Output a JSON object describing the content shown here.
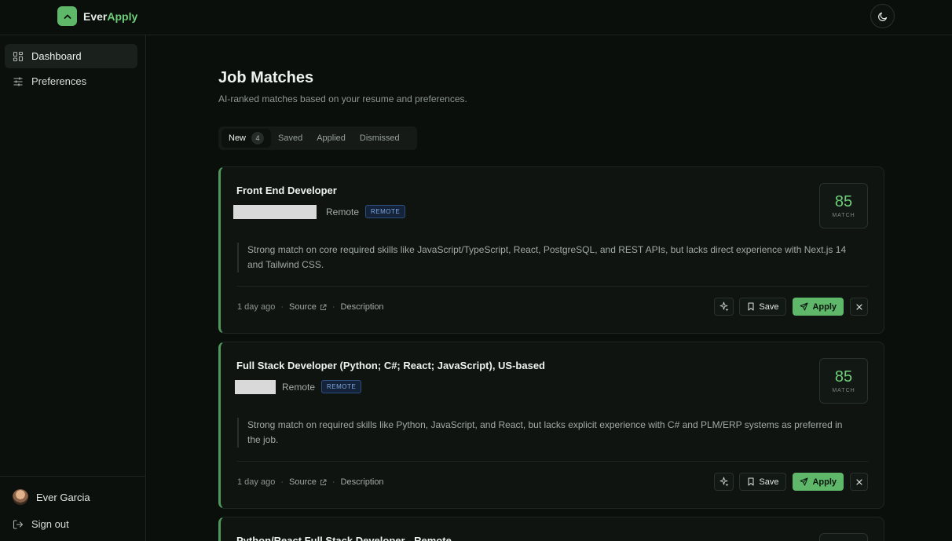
{
  "app": {
    "brand_part1": "Ever",
    "brand_part2": "Apply",
    "accent": "#5fb86a"
  },
  "sidebar": {
    "items": [
      {
        "label": "Dashboard",
        "icon": "grid-icon",
        "active": true
      },
      {
        "label": "Preferences",
        "icon": "sliders-icon",
        "active": false
      }
    ],
    "user_name": "Ever Garcia",
    "signout_label": "Sign out"
  },
  "main": {
    "title": "Job Matches",
    "subtitle": "AI-ranked matches based on your resume and preferences.",
    "tabs": [
      {
        "label": "New",
        "count": "4"
      },
      {
        "label": "Saved"
      },
      {
        "label": "Applied"
      },
      {
        "label": "Dismissed"
      }
    ]
  },
  "jobs": [
    {
      "title": "Front End Developer",
      "location": "Remote",
      "badge": "REMOTE",
      "score": "85",
      "score_label": "MATCH",
      "reason": "Strong match on core required skills like JavaScript/TypeScript, React, PostgreSQL, and REST APIs, but lacks direct experience with Next.js 14 and Tailwind CSS.",
      "posted": "1 day ago",
      "source_label": "Source",
      "description_label": "Description",
      "save_label": "Save",
      "apply_label": "Apply"
    },
    {
      "title": "Full Stack Developer (Python; C#; React; JavaScript), US-based",
      "location": "Remote",
      "badge": "REMOTE",
      "score": "85",
      "score_label": "MATCH",
      "reason": "Strong match on required skills like Python, JavaScript, and React, but lacks explicit experience with C# and PLM/ERP systems as preferred in the job.",
      "posted": "1 day ago",
      "source_label": "Source",
      "description_label": "Description",
      "save_label": "Save",
      "apply_label": "Apply"
    },
    {
      "title": "Python/React Full Stack Developer - Remote"
    }
  ]
}
